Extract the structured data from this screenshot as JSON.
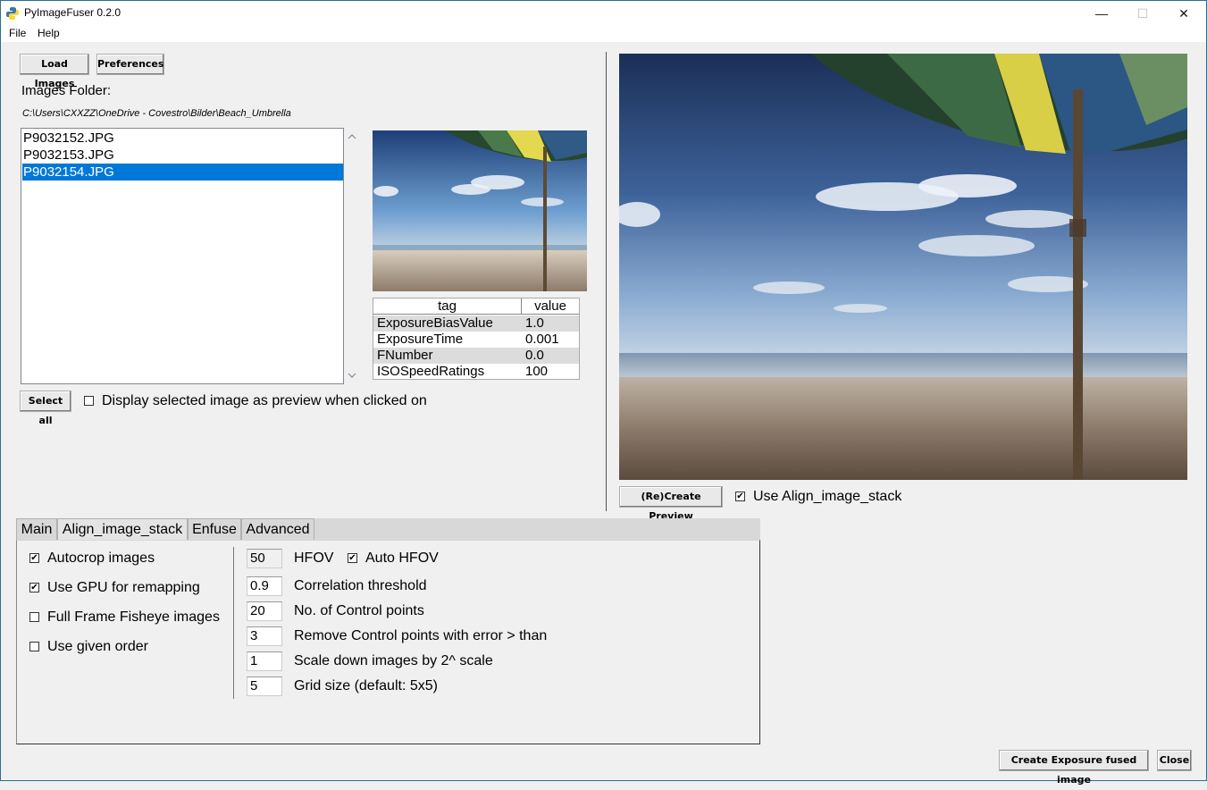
{
  "window": {
    "title": "PyImageFuser 0.2.0",
    "minimize": "—",
    "maximize": "☐",
    "close": "✕"
  },
  "menu": {
    "file": "File",
    "help": "Help"
  },
  "toolbar": {
    "load_images": "Load Images",
    "preferences": "Preferences"
  },
  "folder": {
    "label": "Images Folder:",
    "path": "C:\\Users\\CXXZZ\\OneDrive - Covestro\\Bilder\\Beach_Umbrella"
  },
  "files": {
    "items": [
      "P9032152.JPG",
      "P9032153.JPG",
      "P9032154.JPG"
    ],
    "selected_index": 2
  },
  "exif": {
    "headers": [
      "tag",
      "value"
    ],
    "rows": [
      [
        "ExposureBiasValue",
        "1.0"
      ],
      [
        "ExposureTime",
        "0.001"
      ],
      [
        "FNumber",
        "0.0"
      ],
      [
        "ISOSpeedRatings",
        "100"
      ]
    ]
  },
  "selection": {
    "select_all": "Select all",
    "display_preview_label": "Display selected image as preview when clicked on",
    "display_preview_checked": false
  },
  "preview": {
    "recreate_button": "(Re)Create Preview",
    "use_align_label": "Use Align_image_stack",
    "use_align_checked": true
  },
  "tabs": [
    "Main",
    "Align_image_stack",
    "Enfuse",
    "Advanced"
  ],
  "active_tab": 1,
  "align_options": {
    "checkboxes": [
      {
        "label": "Autocrop images",
        "checked": true
      },
      {
        "label": "Use GPU for remapping",
        "checked": true
      },
      {
        "label": "Full Frame Fisheye images",
        "checked": false
      },
      {
        "label": "Use given order",
        "checked": false
      }
    ],
    "fields": [
      {
        "value": "50",
        "label": "HFOV"
      },
      {
        "value": "0.9",
        "label": "Correlation threshold"
      },
      {
        "value": "20",
        "label": "No. of Control points"
      },
      {
        "value": "3",
        "label": "Remove Control points with error > than"
      },
      {
        "value": "1",
        "label": "Scale down images by 2^ scale"
      },
      {
        "value": "5",
        "label": "Grid size (default: 5x5)"
      }
    ],
    "auto_hfov_label": "Auto HFOV",
    "auto_hfov_checked": true
  },
  "footer": {
    "create_fused": "Create Exposure fused image",
    "close": "Close"
  },
  "colors": {
    "selection": "#0078d7",
    "frame": "#2b6e8e"
  }
}
